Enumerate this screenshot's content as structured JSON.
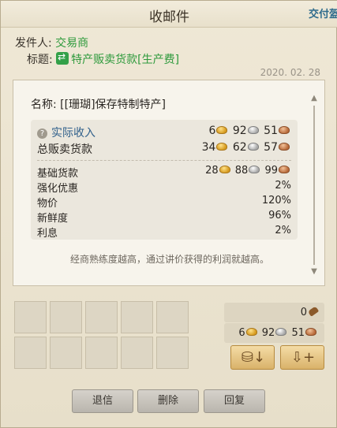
{
  "window": {
    "title": "收邮件",
    "corner_button": "交付盔"
  },
  "mail": {
    "sender_label": "发件人:",
    "sender": "交易商",
    "subject_label": "标题:",
    "subject": "特产贩卖货款[生产费]",
    "date": "2020. 02. 28"
  },
  "detail": {
    "item_label": "名称:",
    "item_name": "[[珊瑚]保存特制特产]",
    "actual_income": {
      "label": "实际收入",
      "gold": "6",
      "silver": "92",
      "copper": "51"
    },
    "total_sale": {
      "label": "总贩卖货款",
      "gold": "34",
      "silver": "62",
      "copper": "57"
    },
    "base_price": {
      "label": "基础货款",
      "gold": "28",
      "silver": "88",
      "copper": "99"
    },
    "rows": [
      {
        "label": "强化优惠",
        "value": "2%"
      },
      {
        "label": "物价",
        "value": "120%"
      },
      {
        "label": "新鲜度",
        "value": "96%"
      },
      {
        "label": "利息",
        "value": "2%"
      }
    ],
    "hint": "经商熟练度越高，通过讲价获得的利润就越高。"
  },
  "attachments": {
    "postage": "0",
    "money": {
      "gold": "6",
      "silver": "92",
      "copper": "51"
    }
  },
  "buttons": {
    "return": "退信",
    "delete": "删除",
    "reply": "回复"
  },
  "colors": {
    "accent_green": "#2e9a3c",
    "label_blue": "#2f5f8a",
    "background": "#e9e2cf"
  }
}
